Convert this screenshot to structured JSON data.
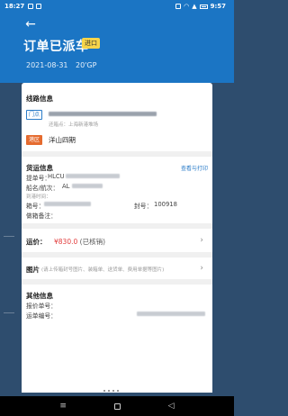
{
  "status_bar": {
    "time": "18:27",
    "right_time": "9:57"
  },
  "header": {
    "title": "订单已派车",
    "badge": "进口",
    "date": "2021-08-31",
    "container_type": "20'GP"
  },
  "route": {
    "title": "线路信息",
    "door_tag": "门点",
    "door_address": "上海市……",
    "door_sub": "还箱点：上海新港堆场",
    "port_tag": "港区",
    "port_name": "洋山四期"
  },
  "cargo": {
    "title": "货运信息",
    "view_print": "查看与打印",
    "bill_label": "提单号：",
    "bill_value": "HLCU",
    "ship_label": "船名/航次：",
    "ship_value": "AL",
    "arrive_label": "到港时间：",
    "box_label": "箱号：",
    "seal_label": "封号：",
    "seal_value": "100918",
    "remark_label": "做箱备注："
  },
  "freight": {
    "label": "运价：",
    "amount": "¥830.0",
    "status": "(已核销)"
  },
  "images": {
    "label": "图片",
    "hint": "(请上传箱封号图片、装箱单、送货单、费用单据等图片)"
  },
  "other": {
    "title": "其他信息",
    "quote_label": "报价单号：",
    "waybill_label": "运单编号："
  },
  "colors": {
    "primary": "#1b75c4",
    "price": "#e23d3d",
    "port_tag": "#e56b2f",
    "badge": "#f6d44a"
  }
}
